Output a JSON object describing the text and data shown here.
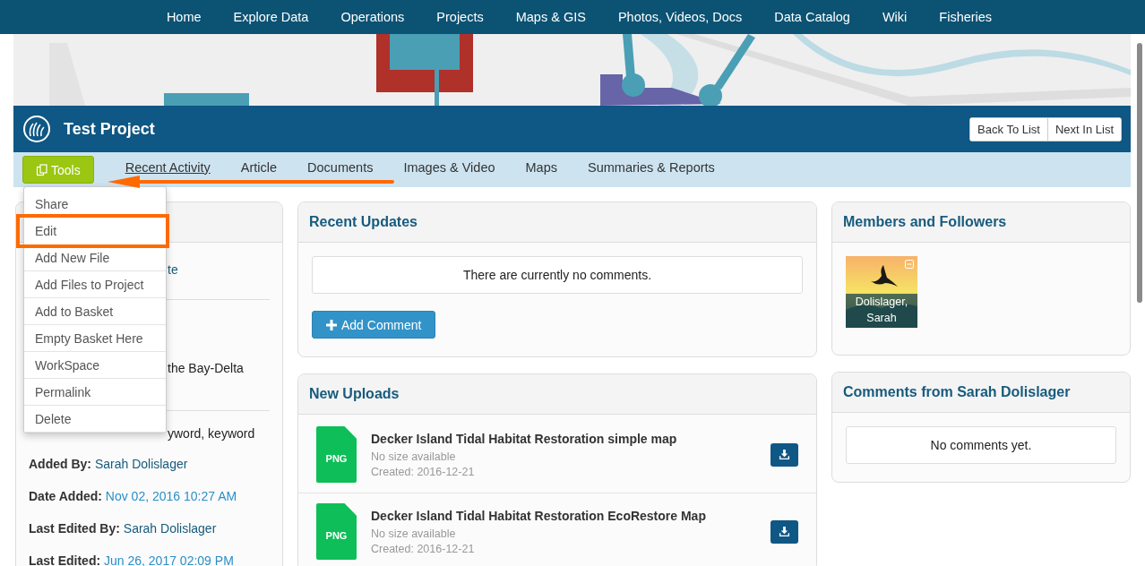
{
  "nav": {
    "items": [
      "Home",
      "Explore Data",
      "Operations",
      "Projects",
      "Maps & GIS",
      "Photos, Videos, Docs",
      "Data Catalog",
      "Wiki",
      "Fisheries"
    ]
  },
  "project": {
    "title": "Test Project",
    "buttons": [
      "Back To List",
      "Next In List"
    ]
  },
  "tabs": {
    "tools": "Tools",
    "items": [
      {
        "label": "Recent Activity",
        "selected": true
      },
      {
        "label": "Article",
        "selected": false
      },
      {
        "label": "Documents",
        "selected": false
      },
      {
        "label": "Images & Video",
        "selected": false
      },
      {
        "label": "Maps",
        "selected": false
      },
      {
        "label": "Summaries & Reports",
        "selected": false
      }
    ]
  },
  "tools_menu": {
    "items": [
      {
        "label": "Share",
        "highlighted": false
      },
      {
        "label": "Edit",
        "highlighted": true
      },
      {
        "label": "Add New File",
        "highlighted": false
      },
      {
        "label": "Add Files to Project",
        "highlighted": false
      },
      {
        "label": "Add to Basket",
        "highlighted": false
      },
      {
        "label": "Empty Basket Here",
        "highlighted": false
      },
      {
        "label": "WorkSpace",
        "highlighted": false
      },
      {
        "label": "Permalink",
        "highlighted": false
      },
      {
        "label": "Delete",
        "highlighted": false
      }
    ]
  },
  "left_card": {
    "fragments": [
      {
        "kind": "link",
        "text": "te"
      },
      {
        "kind": "text",
        "text": "the Bay-Delta"
      },
      {
        "kind": "text",
        "text": "yword, keyword"
      }
    ],
    "fields": [
      {
        "label": "Added By:",
        "value": "Sarah Dolislager",
        "kind": "person"
      },
      {
        "label": "Date Added:",
        "value": "Nov 02, 2016 10:27 AM",
        "kind": "date"
      },
      {
        "label": "Last Edited By:",
        "value": "Sarah Dolislager",
        "kind": "person"
      },
      {
        "label": "Last Edited:",
        "value": "Jun 26, 2017 02:09 PM",
        "kind": "date"
      }
    ]
  },
  "recent_updates": {
    "title": "Recent Updates",
    "message": "There are currently no comments.",
    "button": "Add Comment"
  },
  "new_uploads": {
    "title": "New Uploads",
    "files": [
      {
        "type": "PNG",
        "name": "Decker Island Tidal Habitat Restoration simple map",
        "size": "No size available",
        "created": "Created: 2016-12-21"
      },
      {
        "type": "PNG",
        "name": "Decker Island Tidal Habitat Restoration EcoRestore Map",
        "size": "No size available",
        "created": "Created: 2016-12-21"
      }
    ]
  },
  "members": {
    "title": "Members and Followers",
    "people": [
      {
        "name": "Dolislager, Sarah"
      }
    ]
  },
  "comments": {
    "title": "Comments from Sarah Dolislager",
    "message": "No comments yet."
  }
}
